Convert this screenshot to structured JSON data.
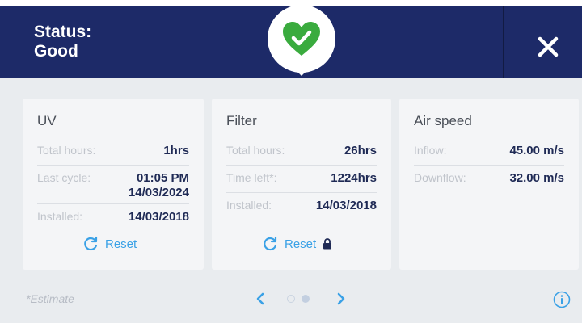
{
  "header": {
    "status_line1": "Status:",
    "status_line2": "Good",
    "status_icon": "heart-check-icon",
    "close_icon": "close-icon",
    "colors": {
      "background": "#1d2a68",
      "status_good": "#3aab3e"
    }
  },
  "cards": {
    "uv": {
      "title": "UV",
      "total_hours_label": "Total hours:",
      "total_hours_value": "1hrs",
      "last_cycle_label": "Last cycle:",
      "last_cycle_time": "01:05 PM",
      "last_cycle_date": "14/03/2024",
      "installed_label": "Installed:",
      "installed_value": "14/03/2018",
      "reset_label": "Reset"
    },
    "filter": {
      "title": "Filter",
      "total_hours_label": "Total hours:",
      "total_hours_value": "26hrs",
      "time_left_label": "Time left*:",
      "time_left_value": "1224hrs",
      "installed_label": "Installed:",
      "installed_value": "14/03/2018",
      "reset_label": "Reset",
      "lock_icon": "lock-icon"
    },
    "air_speed": {
      "title": "Air speed",
      "inflow_label": "Inflow:",
      "inflow_value": "45.00 m/s",
      "downflow_label": "Downflow:",
      "downflow_value": "32.00 m/s"
    }
  },
  "footer": {
    "estimate_note": "*Estimate",
    "pager": {
      "pages": 2,
      "current": 2
    },
    "info_icon": "info-icon",
    "accent": "#3aa1e6"
  }
}
